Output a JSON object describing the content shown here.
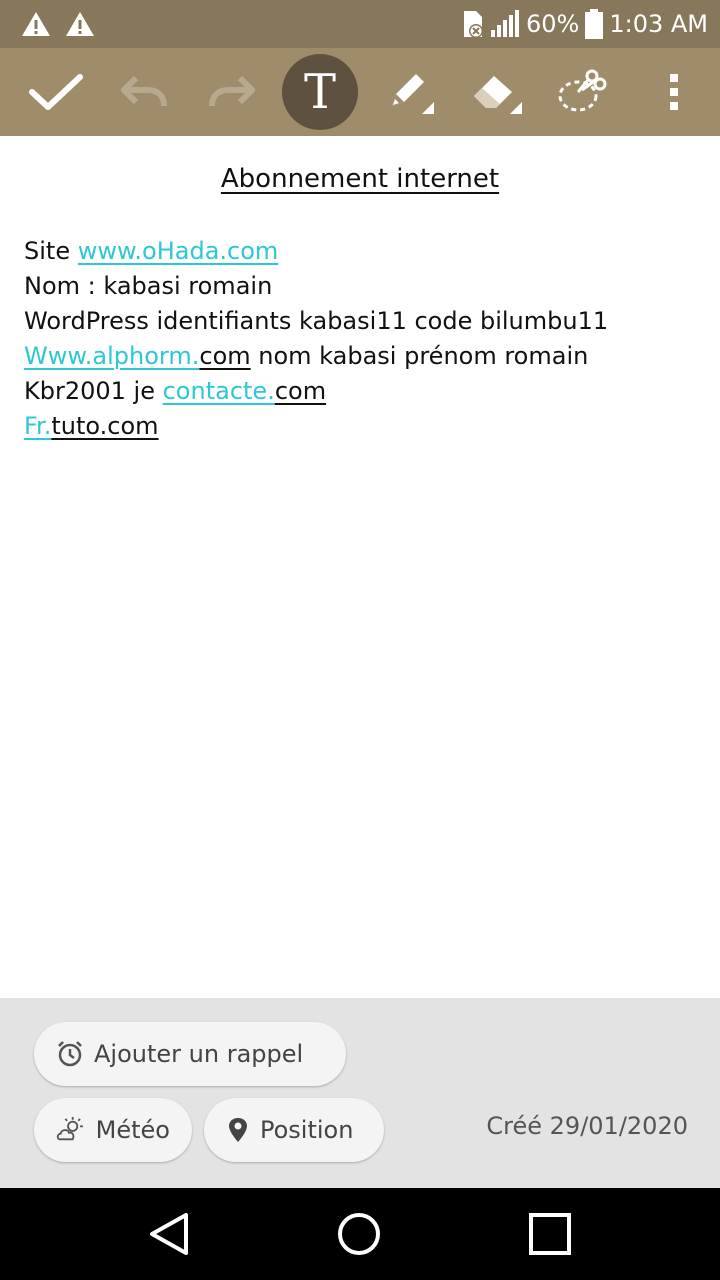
{
  "status_bar": {
    "battery_percent": "60%",
    "time": "1:03 AM",
    "icons": [
      "warning-icon",
      "warning-icon",
      "sd-card-icon",
      "signal-icon",
      "battery-icon"
    ]
  },
  "toolbar": {
    "tools": [
      "check-icon",
      "undo-icon",
      "redo-icon",
      "text-tool-icon",
      "pen-tool-icon",
      "eraser-tool-icon",
      "lasso-tool-icon",
      "more-menu-icon"
    ],
    "active_tool": "text",
    "text_tool_glyph": "T"
  },
  "note": {
    "title": "Abonnement internet",
    "line1": {
      "prefix": "Site ",
      "link": "www.oHada.com"
    },
    "line2": "Nom : kabasi romain",
    "line3": "WordPress identifiants kabasi11 code bilumbu11",
    "line4": {
      "link": "Www.alphorm.",
      "link_rest": "com",
      "suffix": " nom kabasi prénom romain"
    },
    "line5": {
      "prefix": "Kbr2001 je ",
      "link": "contacte.",
      "link_rest": "com"
    },
    "line6": {
      "link": "Fr.",
      "link_rest": "tuto.com"
    }
  },
  "bottom_panel": {
    "reminder_label": "Ajouter un rappel",
    "weather_label": "Météo",
    "location_label": "Position",
    "created_label": "Créé 29/01/2020"
  },
  "colors": {
    "status_bar": "#87775b",
    "toolbar": "#9f8c6a",
    "active_tool": "#5e5140",
    "link": "#2ec7d4",
    "panel": "#e3e3e3"
  }
}
